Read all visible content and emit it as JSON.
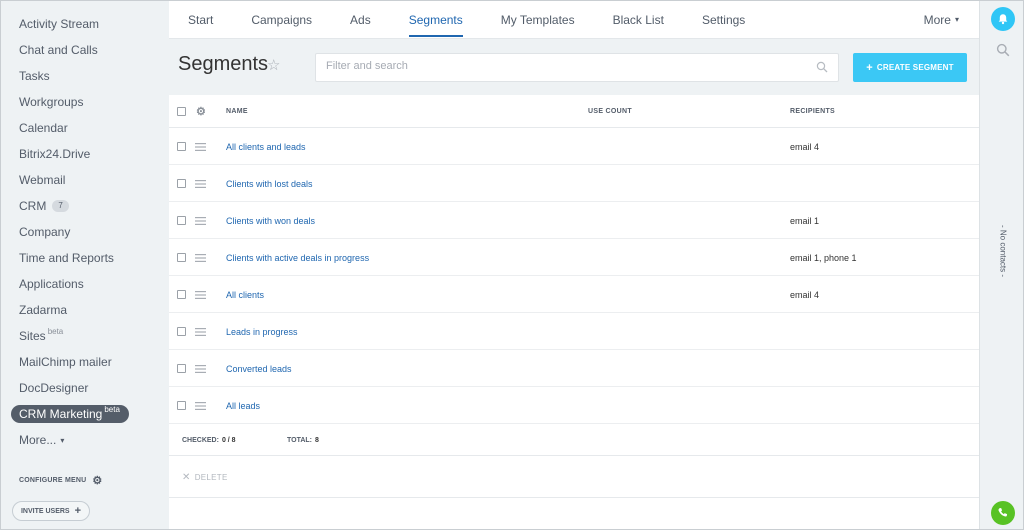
{
  "sidebar": {
    "items": [
      {
        "label": "Activity Stream"
      },
      {
        "label": "Chat and Calls"
      },
      {
        "label": "Tasks"
      },
      {
        "label": "Workgroups"
      },
      {
        "label": "Calendar"
      },
      {
        "label": "Bitrix24.Drive"
      },
      {
        "label": "Webmail"
      },
      {
        "label": "CRM",
        "counter": "7"
      },
      {
        "label": "Company"
      },
      {
        "label": "Time and Reports"
      },
      {
        "label": "Applications"
      },
      {
        "label": "Zadarma"
      },
      {
        "label": "Sites",
        "sup": "beta"
      },
      {
        "label": "MailChimp mailer"
      },
      {
        "label": "DocDesigner"
      },
      {
        "label": "CRM Marketing",
        "sup": "beta",
        "active": true
      }
    ],
    "more_label": "More...",
    "configure_label": "CONFIGURE MENU",
    "invite_label": "INVITE USERS"
  },
  "topnav": {
    "tabs": [
      "Start",
      "Campaigns",
      "Ads",
      "Segments",
      "My Templates",
      "Black List",
      "Settings"
    ],
    "active_tab": "Segments",
    "more_label": "More"
  },
  "toolbar": {
    "title": "Segments",
    "search_placeholder": "Filter and search",
    "create_label": "CREATE SEGMENT"
  },
  "grid": {
    "columns": {
      "name": "NAME",
      "use_count": "USE COUNT",
      "recipients": "RECIPIENTS"
    },
    "rows": [
      {
        "name": "All clients and leads",
        "use_count": "",
        "recipients": "email 4"
      },
      {
        "name": "Clients with lost deals",
        "use_count": "",
        "recipients": ""
      },
      {
        "name": "Clients with won deals",
        "use_count": "",
        "recipients": "email 1"
      },
      {
        "name": "Clients with active deals in progress",
        "use_count": "",
        "recipients": "email 1, phone 1"
      },
      {
        "name": "All clients",
        "use_count": "",
        "recipients": "email 4"
      },
      {
        "name": "Leads in progress",
        "use_count": "",
        "recipients": ""
      },
      {
        "name": "Converted leads",
        "use_count": "",
        "recipients": ""
      },
      {
        "name": "All leads",
        "use_count": "",
        "recipients": ""
      }
    ],
    "footer": {
      "checked_label": "CHECKED:",
      "checked_value": "0 / 8",
      "total_label": "TOTAL:",
      "total_value": "8"
    },
    "delete_label": "DELETE"
  },
  "rail": {
    "no_contacts_label": "- No contacts -"
  },
  "colors": {
    "accent": "#2067b0",
    "create_button": "#3bc8f5",
    "bell": "#2fc6f6",
    "phone": "#58c224",
    "active_menu": "#545d69"
  },
  "icons": {
    "star": "star-icon",
    "search": "search-icon",
    "gear": "gear-icon",
    "drag": "drag-handle-icon",
    "bell": "bell-icon",
    "phone": "phone-icon"
  }
}
